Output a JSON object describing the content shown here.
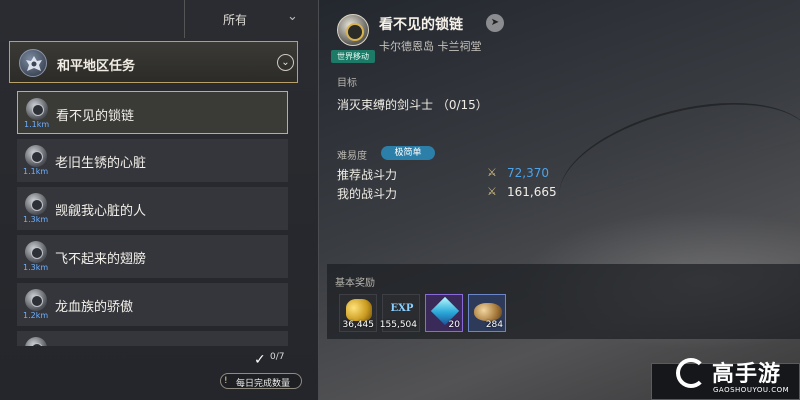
{
  "filter": {
    "label": "所有",
    "chevron": "v"
  },
  "region": {
    "title": "和平地区任务",
    "toggle": "⌄"
  },
  "quests": [
    {
      "name": "看不见的锁链",
      "distance": "1.1km"
    },
    {
      "name": "老旧生锈的心脏",
      "distance": "1.1km"
    },
    {
      "name": "觊觎我心脏的人",
      "distance": "1.3km"
    },
    {
      "name": "飞不起来的翅膀",
      "distance": "1.3km"
    },
    {
      "name": "龙血族的骄傲",
      "distance": "1.2km"
    }
  ],
  "daily": {
    "count": "0/7",
    "label": "每日完成数量",
    "info_icon": "!"
  },
  "detail": {
    "world_tag": "世界移动",
    "title": "看不见的锁链",
    "location": "卡尔德恩岛 卡兰祠堂",
    "goal_label": "目标",
    "goal_text": "消灭束缚的剑斗士 （0/15）",
    "difficulty_label": "难易度",
    "difficulty_value": "极简单",
    "recommended_label": "推荐战斗力",
    "recommended_value": "72,370",
    "recommended_color": "#4ea3e8",
    "my_label": "我的战斗力",
    "my_value": "161,665",
    "my_color": "#f0ede6"
  },
  "rewards": {
    "label": "基本奖励",
    "items": [
      {
        "icon": "gold-coins-icon",
        "qty": "36,445"
      },
      {
        "icon": "exp-icon",
        "text": "EXP",
        "qty": "155,504"
      },
      {
        "icon": "blue-crystal-icon",
        "qty": "20"
      },
      {
        "icon": "ore-icon",
        "qty": "284"
      }
    ]
  },
  "watermark": {
    "text": "高手游",
    "url": "GAOSHOUYOU.COM"
  }
}
